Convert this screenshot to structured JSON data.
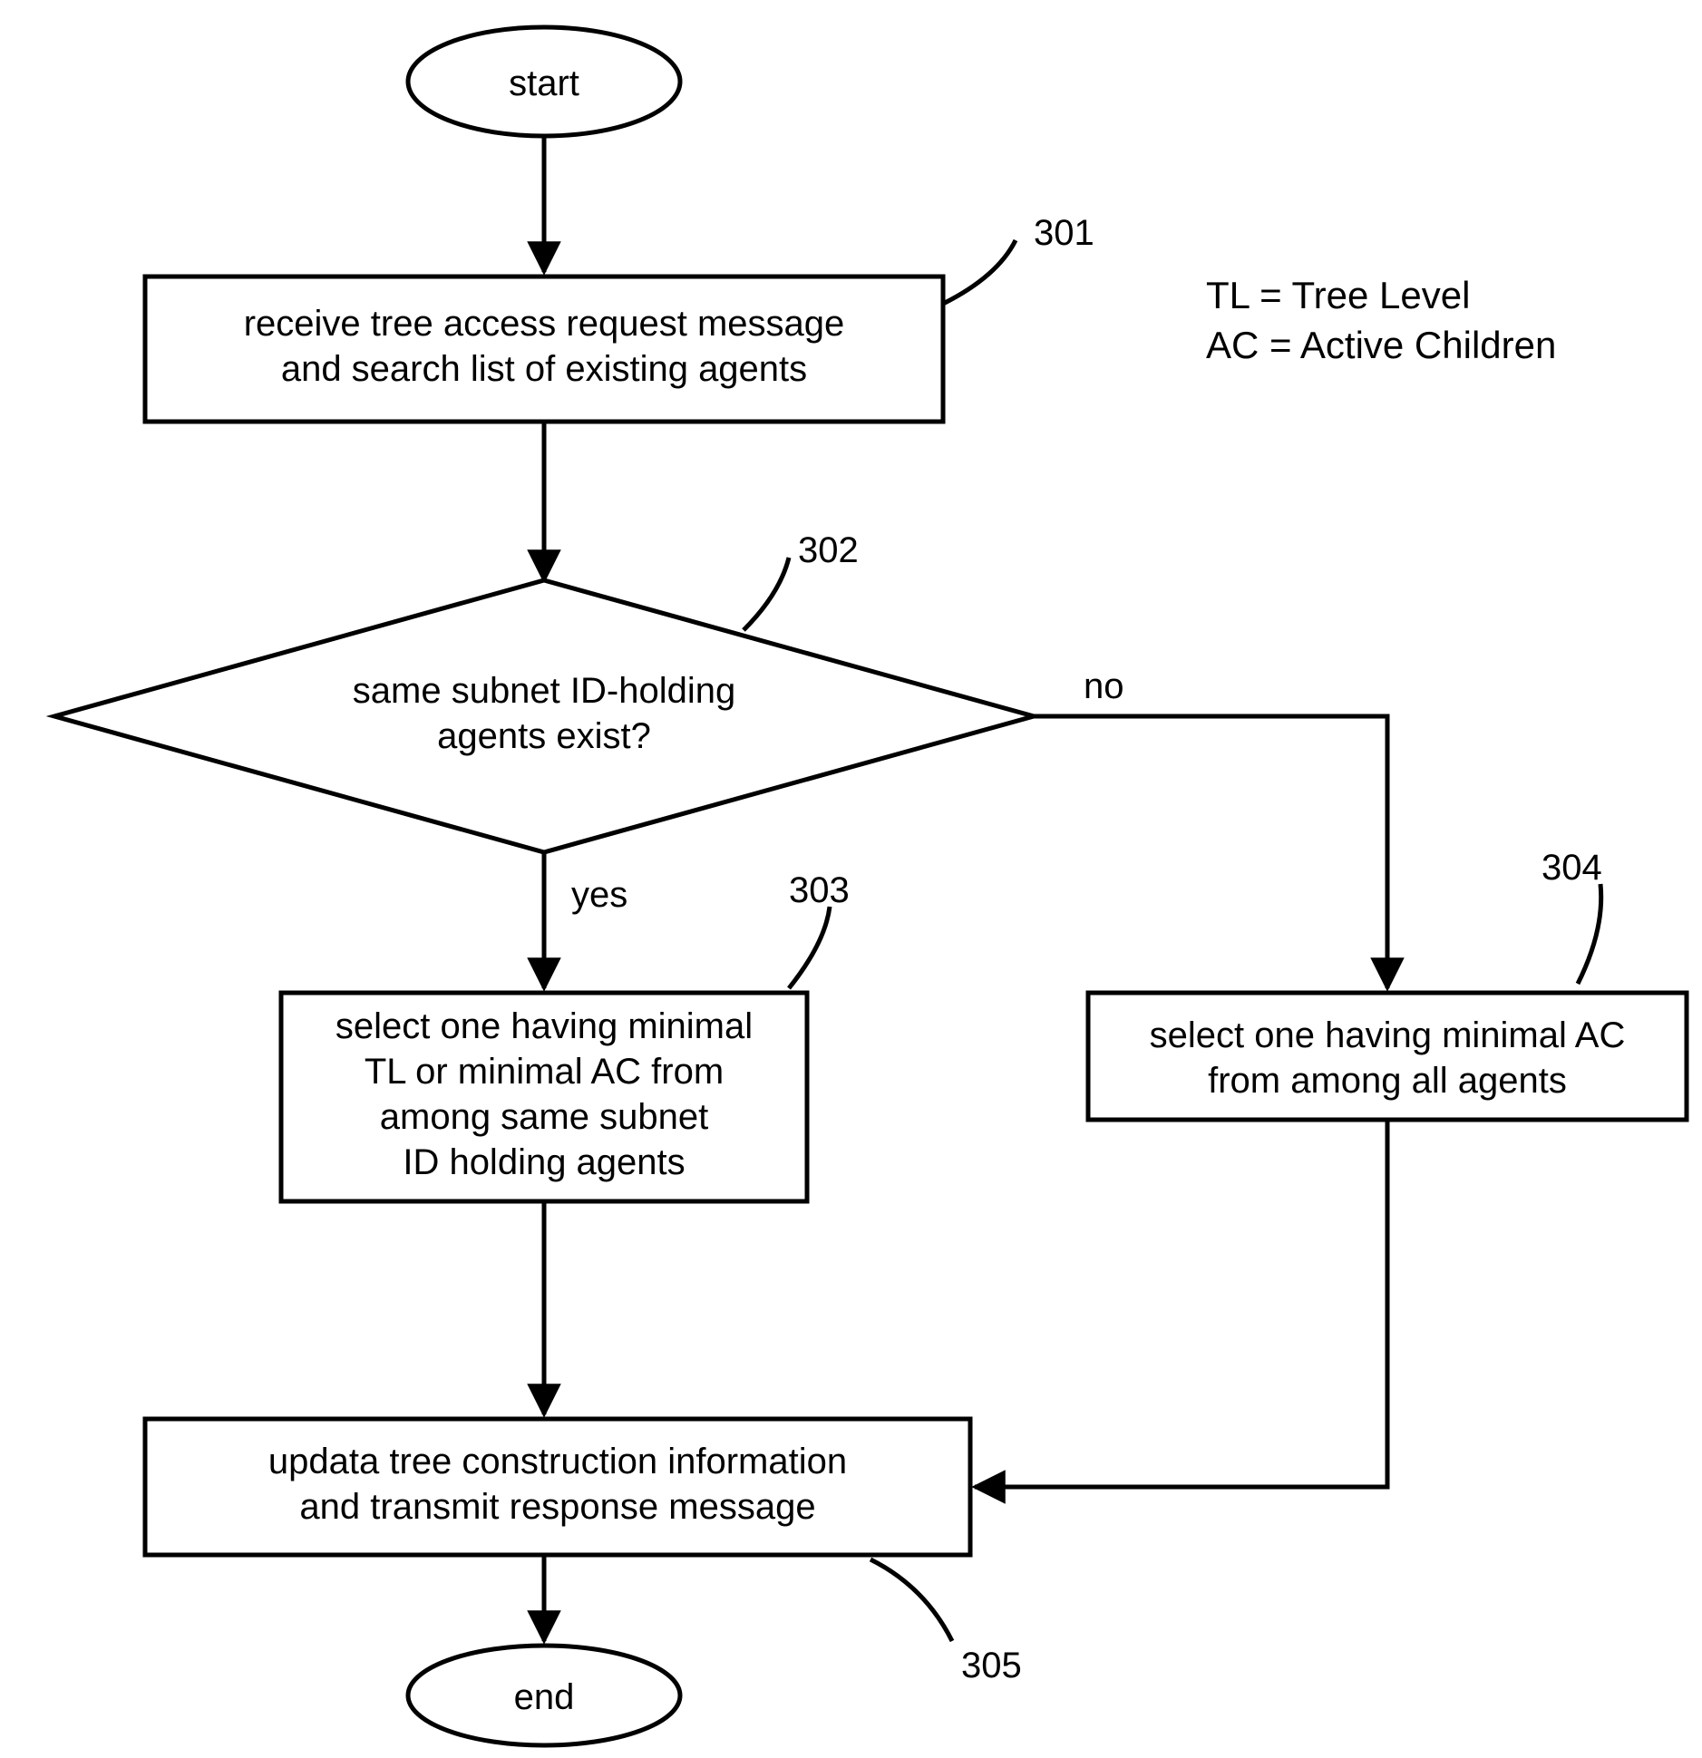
{
  "nodes": {
    "start": {
      "label": "start",
      "ref": ""
    },
    "end": {
      "label": "end",
      "ref": ""
    },
    "step301": {
      "ref": "301",
      "lines": [
        "receive tree access request message",
        "and search list of existing agents"
      ]
    },
    "dec302": {
      "ref": "302",
      "lines": [
        "same subnet ID-holding",
        "agents exist?"
      ],
      "yes": "yes",
      "no": "no"
    },
    "step303": {
      "ref": "303",
      "lines": [
        "select one having minimal",
        "TL or minimal AC from",
        "among same subnet",
        "ID holding agents"
      ]
    },
    "step304": {
      "ref": "304",
      "lines": [
        "select one having minimal AC",
        "from among all agents"
      ]
    },
    "step305": {
      "ref": "305",
      "lines": [
        "updata tree construction information",
        "and transmit response message"
      ]
    }
  },
  "legend": {
    "line1": "TL = Tree Level",
    "line2": "AC = Active Children"
  }
}
